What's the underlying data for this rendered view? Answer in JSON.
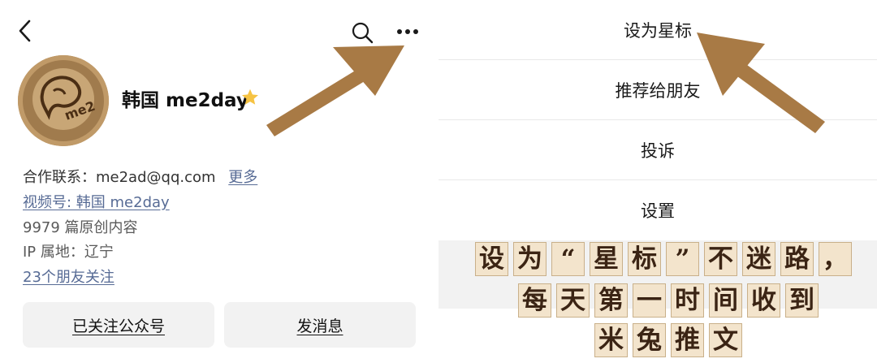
{
  "profile": {
    "name": "韩国 me2day",
    "contact_label": "合作联系：",
    "contact_value": "me2ad@qq.com",
    "more_label": "更多",
    "channel_label": "视频号: 韩国 me2day",
    "articles": "9979 篇原创内容",
    "ip_location": "IP 属地：辽宁",
    "friends_following": "23个朋友关注",
    "followed_button": "已关注公众号",
    "message_button": "发消息"
  },
  "menu": {
    "items": [
      {
        "label": "设为星标"
      },
      {
        "label": "推荐给朋友"
      },
      {
        "label": "投诉"
      },
      {
        "label": "设置"
      }
    ]
  },
  "caption": {
    "line1": [
      "设",
      "为",
      "“",
      "星",
      "标",
      "”",
      "不",
      "迷",
      "路",
      "，"
    ],
    "line2": [
      "每",
      "天",
      "第",
      "一",
      "时",
      "间",
      "收",
      "到"
    ],
    "line3": [
      "米",
      "兔",
      "推",
      "文"
    ]
  },
  "colors": {
    "link": "#576b95",
    "star": "#f6c343",
    "arrow": "#a87a45",
    "banner_bg": "#f3e4cc",
    "banner_text": "#3b2414"
  },
  "icons": {
    "back": "chevron-left-icon",
    "search": "search-icon",
    "more": "more-dots-icon",
    "star": "star-icon"
  }
}
